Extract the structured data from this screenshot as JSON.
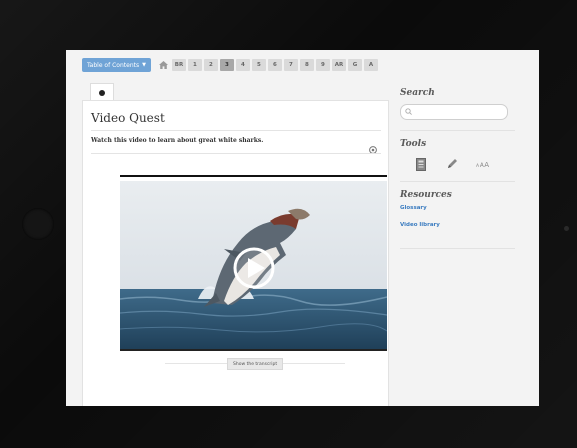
{
  "nav": {
    "toc_label": "Table of Contents",
    "chips": [
      "BR",
      "1",
      "2",
      "3",
      "4",
      "5",
      "6",
      "7",
      "8",
      "9",
      "AR",
      "G",
      "A"
    ],
    "active_chip": "3",
    "accent_color": "#6fa3d6"
  },
  "main": {
    "title": "Video Quest",
    "instruction": "Watch this video to learn about great white sharks.",
    "transcript_button": "Show the transcript"
  },
  "sidebar": {
    "search_heading": "Search",
    "search_placeholder": "",
    "tools_heading": "Tools",
    "tools": [
      "notebook-icon",
      "pencil-icon",
      "text-size-icon"
    ],
    "resources_heading": "Resources",
    "resources": [
      "Glossary",
      "Video library"
    ],
    "link_color": "#3b7cc0"
  }
}
